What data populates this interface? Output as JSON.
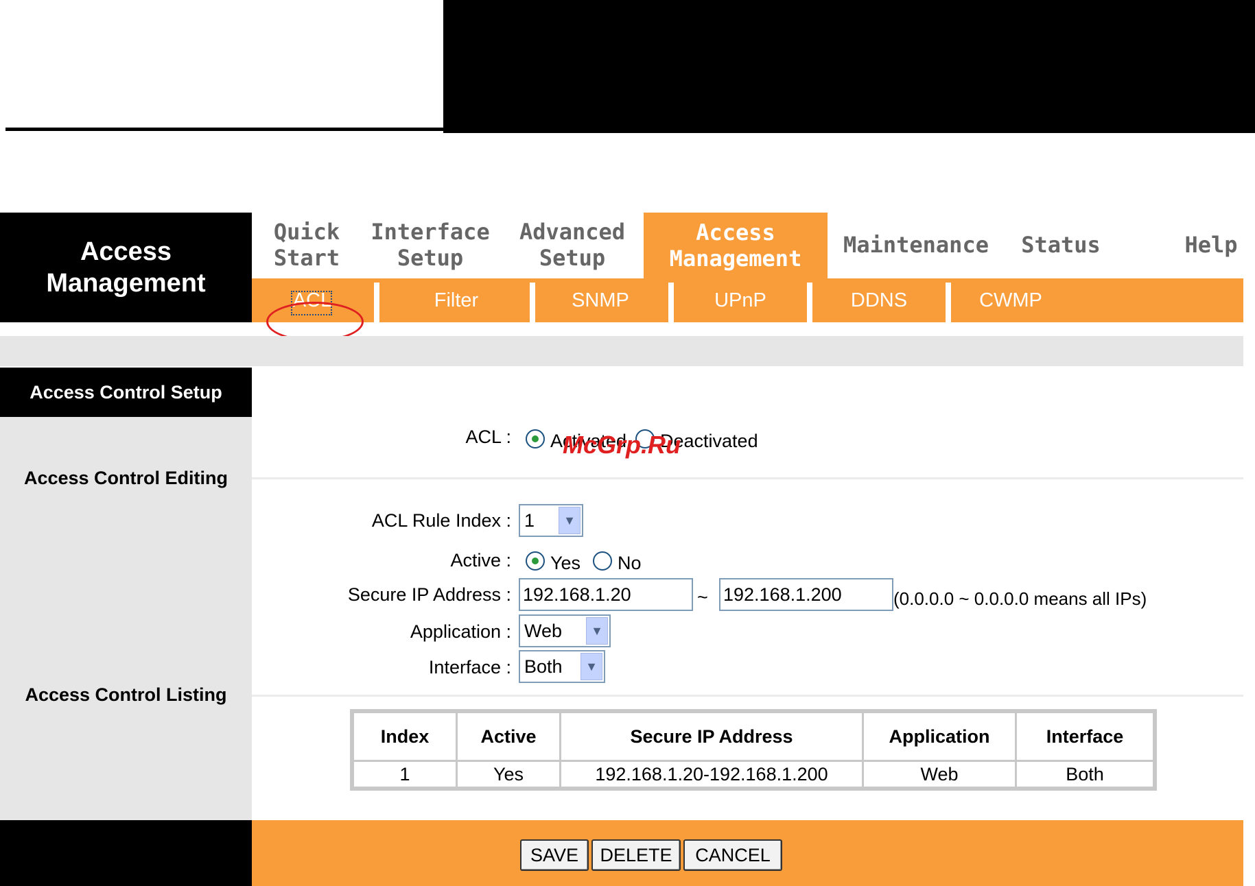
{
  "header": {
    "brand": "Access\nManagement"
  },
  "nav": {
    "tabs": [
      {
        "label": "Quick\nStart",
        "active": false
      },
      {
        "label": "Interface\nSetup",
        "active": false
      },
      {
        "label": "Advanced\nSetup",
        "active": false
      },
      {
        "label": "Access\nManagement",
        "active": true
      },
      {
        "label": "Maintenance",
        "active": false
      },
      {
        "label": "Status",
        "active": false
      },
      {
        "label": "Help",
        "active": false
      }
    ],
    "subtabs": [
      "ACL",
      "Filter",
      "SNMP",
      "UPnP",
      "DDNS",
      "CWMP"
    ],
    "active_subtab": "ACL"
  },
  "sections": {
    "setup": "Access Control Setup",
    "editing": "Access Control Editing",
    "listing": "Access Control Listing"
  },
  "acl": {
    "label": "ACL :",
    "options": [
      "Activated",
      "Deactivated"
    ],
    "selected": "Activated"
  },
  "editing": {
    "rule_index_label": "ACL Rule Index :",
    "rule_index_value": "1",
    "active_label": "Active :",
    "active_options": [
      "Yes",
      "No"
    ],
    "active_selected": "Yes",
    "secure_ip_label": "Secure IP Address :",
    "ip_start": "192.168.1.20",
    "ip_sep": "~",
    "ip_end": "192.168.1.200",
    "ip_hint": "(0.0.0.0 ~ 0.0.0.0 means all IPs)",
    "application_label": "Application :",
    "application_value": "Web",
    "interface_label": "Interface :",
    "interface_value": "Both"
  },
  "listing": {
    "columns": [
      "Index",
      "Active",
      "Secure IP Address",
      "Application",
      "Interface"
    ],
    "rows": [
      [
        "1",
        "Yes",
        "192.168.1.20-192.168.1.200",
        "Web",
        "Both"
      ]
    ]
  },
  "buttons": {
    "save": "SAVE",
    "delete": "DELETE",
    "cancel": "CANCEL"
  },
  "watermark": "McGrp.Ru",
  "colors": {
    "accent": "#f99d3b",
    "annotation": "#e02020"
  }
}
